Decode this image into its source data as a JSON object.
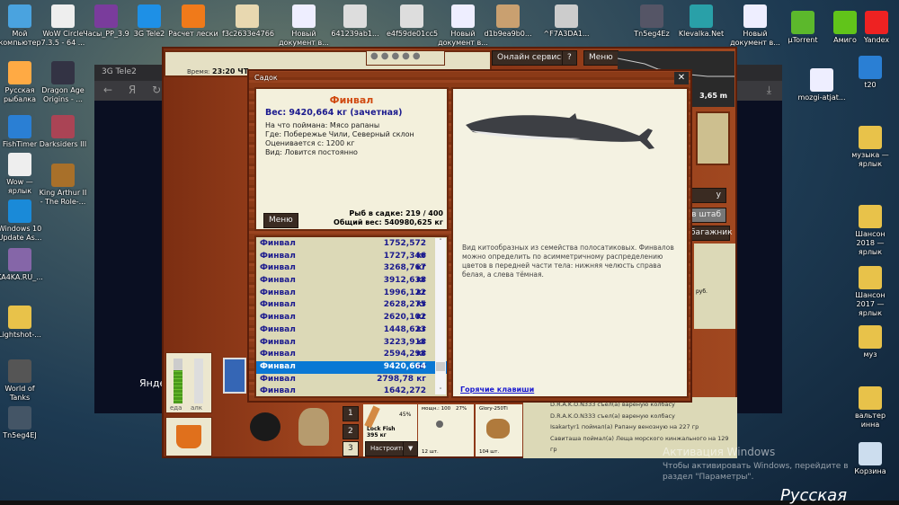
{
  "desktop": {
    "icons": [
      "Мой компьютер",
      "WoW Circle 7.3.5 - 64 ...",
      "Часы_PP_3.9",
      "3G Tele2",
      "Расчет лески",
      "f3c2633e4766",
      "Новый документ в...",
      "641239ab1...",
      "e4f59de01cc5",
      "Новый документ в...",
      "d1b9ea9b0...",
      "^F7A3DA1...",
      "Tn5eg4Ez",
      "Klevalka.Net",
      "Новый документ в...",
      "µTorrent",
      "Амиго",
      "Yandex",
      "Русская рыбалка",
      "Dragon Age Origins - ...",
      "FishTimer",
      "Darksiders III",
      "Wow — ярлык",
      "King Arthur II - The Role-...",
      "Windows 10 Update As...",
      "KA4KA.RU_...",
      "Lightshot-...",
      "World of Tanks",
      "Tn5eg4EJ",
      "t20",
      "mozgi-atjat...",
      "музыка — ярлык",
      "Шансон 2018 — ярлык",
      "Шансон 2017 — ярлык",
      "муз",
      "вальтер инна",
      "Корзина"
    ],
    "activation_title": "Активация Windows",
    "activation_text": "Чтобы активировать Windows, перейдите в раздел \"Параметры\".",
    "taskbar_text": "Русская"
  },
  "browser": {
    "title": "3G Tele2",
    "back": "←",
    "logo": "Я",
    "reload": "↻",
    "download": "⤓",
    "partial_text": "Яндек"
  },
  "game": {
    "time_label": "Время:",
    "time_value": "23:20 ЧТ",
    "online_services": "Онлайн сервисы",
    "help": "?",
    "menu": "Меню",
    "depth": "3,65 m",
    "side_buttons": [
      "у",
      "в штаб",
      "багажник"
    ],
    "side_text": [
      "рyб."
    ],
    "food_label": "еда",
    "alc_label": "алк",
    "food_level": 0.75,
    "alc_level": 0.0,
    "slots": [
      "1",
      "2",
      "3"
    ],
    "rod": {
      "name": "Lock Fish",
      "weight": "395 кг",
      "percent": "45%",
      "setup": "Настроить",
      "filter": "▼"
    },
    "reel": {
      "power": "мощн.: 100",
      "percent": "27%",
      "count": "12 шт."
    },
    "bait": {
      "name": "Glory-250Ti",
      "count": "104 шт."
    },
    "chat": [
      "D.R.A.K.O.N333 съел(а) вареную колбасу",
      "D.R.A.K.O.N333 съел(а) вареную колбасу",
      "Isakartyr1 поймал(а) Рапану венозную на 227 гр",
      "Савиташа поймал(а) Леща морского кинжального на 129 гр"
    ]
  },
  "sadok": {
    "title": "Садок",
    "close": "✕",
    "fish_name": "Финвал",
    "weight": "Вес: 9420,664 кг (зачетная)",
    "details": [
      "На что поймана: Мясо рапаны",
      "Где: Побережье Чили, Северный склон",
      "Оценивается с: 1200 кг",
      "Вид: Ловится постоянно"
    ],
    "menu": "Меню",
    "count": "Рыб в садке: 219 / 400",
    "total": "Общий вес: 540980,625 кг",
    "description": "Вид китообразных из семейства полосатиковых. Финвалов можно определить по асимметричному распределению цветов в передней части тела: нижняя челюсть справа белая, а слева тёмная.",
    "hotkeys": "Горячие клавиши",
    "selected_index": 10,
    "list": [
      {
        "name": "Финвал",
        "weight": "1752,572 кг"
      },
      {
        "name": "Финвал",
        "weight": "1727,346 кг"
      },
      {
        "name": "Финвал",
        "weight": "3268,767 кг"
      },
      {
        "name": "Финвал",
        "weight": "3912,638 кг"
      },
      {
        "name": "Финвал",
        "weight": "1996,122 кг"
      },
      {
        "name": "Финвал",
        "weight": "2628,275 кг"
      },
      {
        "name": "Финвал",
        "weight": "2620,102 кг"
      },
      {
        "name": "Финвал",
        "weight": "1448,623 кг"
      },
      {
        "name": "Финвал",
        "weight": "3223,918 кг"
      },
      {
        "name": "Финвал",
        "weight": "2594,298 кг"
      },
      {
        "name": "Финвал",
        "weight": "9420,664 кг"
      },
      {
        "name": "Финвал",
        "weight": "2798,78 кг"
      },
      {
        "name": "Финвал",
        "weight": "1642,272 кг"
      }
    ]
  }
}
